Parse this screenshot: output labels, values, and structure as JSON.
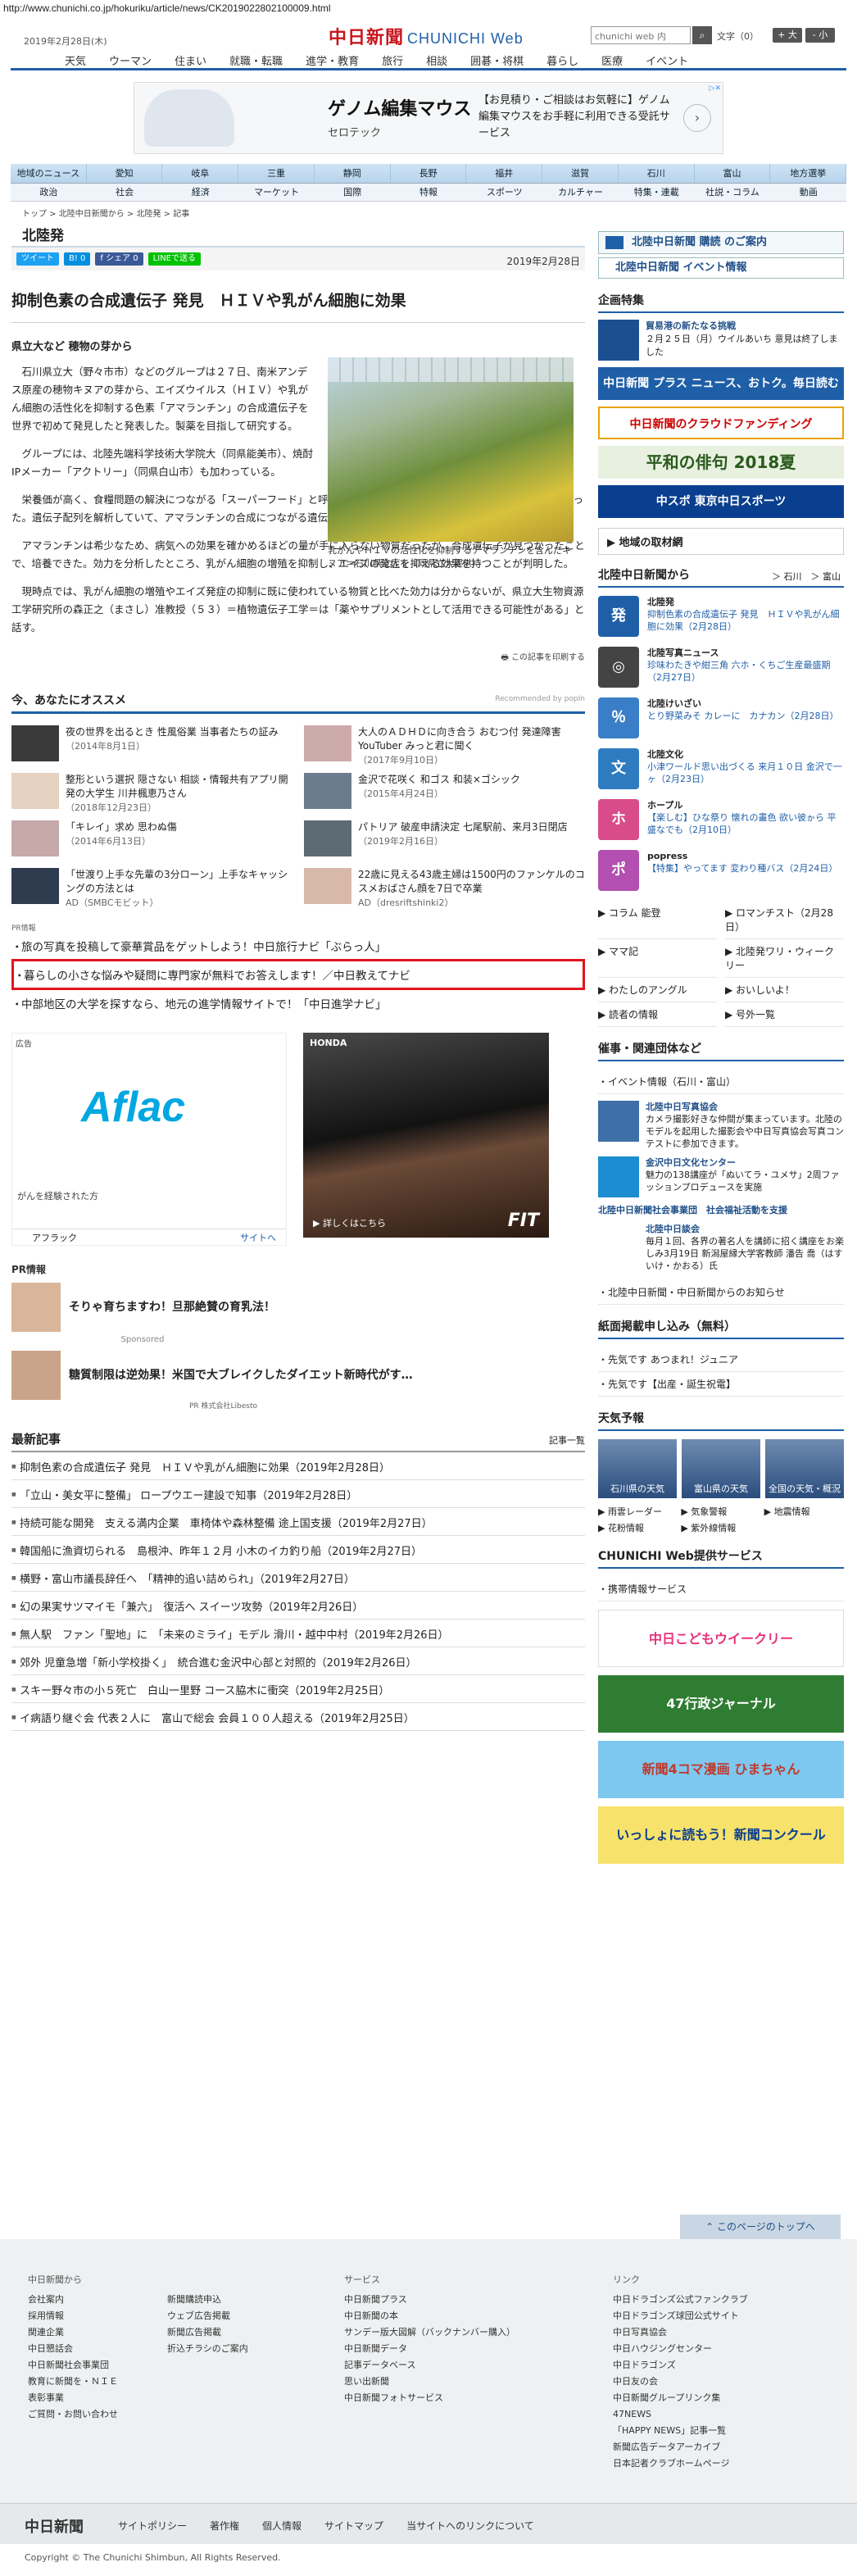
{
  "url": "http://www.chunichi.co.jp/hokuriku/article/news/CK2019022802100009.html",
  "header": {
    "date": "2019年2月28日(木)",
    "logo": "中日新聞",
    "logo_web": "CHUNICHI Web",
    "search_placeholder": "chunichi web 内",
    "memo": "文字（0）",
    "font_large": "+ 大",
    "font_small": "- 小"
  },
  "gnav": [
    "天気",
    "ウーマン",
    "住まい",
    "就職・転職",
    "進学・教育",
    "旅行",
    "相談",
    "囲碁・将棋",
    "暮らし",
    "医療",
    "イベント"
  ],
  "top_ad": {
    "title": "ゲノム編集マウス",
    "brand": "セロテック",
    "text": "【お見積り・ご相談はお気軽に】ゲノム編集マウスをお手軽に利用できる受託サービス",
    "arrow": "›"
  },
  "subnav1": [
    "地域のニュース",
    "愛知",
    "岐阜",
    "三重",
    "静岡",
    "長野",
    "福井",
    "滋賀",
    "石川",
    "富山",
    "地方選挙"
  ],
  "subnav2": [
    "政治",
    "社会",
    "経済",
    "マーケット",
    "国際",
    "特報",
    "スポーツ",
    "カルチャー",
    "特集・連載",
    "社説・コラム",
    "動画"
  ],
  "breadcrumb": "トップ > 北陸中日新聞から > 北陸発 > 記事",
  "section_title": "北陸発",
  "share": {
    "tweet": "ツイート",
    "hatena": "B! 0",
    "fb": "f シェア 0",
    "line": "LINEで送る",
    "pub_date": "2019年2月28日"
  },
  "article": {
    "title": "抑制色素の合成遺伝子 発見　ＨＩＶや乳がん細胞に効果",
    "subtitle": "県立大など 穂物の芽から",
    "caption": "乳がんやＨＩＶの活性化を抑制するアマランチンを含んだキヌア＝石川県立大で（同県立大提供）",
    "p1": "石川県立大（野々市市）などのグループは２７日、南米アンデス原産の穂物キヌアの芽から、エイズウイルス（ＨＩＶ）や乳がん細胞の活性化を抑制する色素「アマランチン」の合成遺伝子を世界で初めて発見したと発表した。製薬を目指して研究する。",
    "p2": "グループには、北陸先端科学技術大学院大（同県能美市）、焼酎IPメーカー「アクトリー」（同県白山市）も加わっている。",
    "p3": "栄養価が高く、食糧問題の解決につながる「スーパーフード」と呼ばれるキヌアの栽培方法を探っている過程で、見つかった。遺伝子配列を解析していて、アマランチンの合成につながる遺伝子が含まれているのが明らかになった。",
    "p4": "アマランチンは希少なため、病気への効果を確かめるほどの量が手に入らない物質だったが、合成遺伝子が見つかったことで、培養できた。効力を分析したところ、乳がん細胞の増殖を抑制し、エイズの発症を抑える効果を持つことが判明した。",
    "p5": "現時点では、乳がん細胞の増殖やエイズ発症の抑制に既に使われている物質と比べた効力は分からないが、県立大生物資源工学研究所の森正之（まさし）准教授（５３）＝植物遺伝子工学＝は「薬やサプリメントとして活用できる可能性がある」と話す。",
    "share_note": "この記事を印刷する"
  },
  "recommend": {
    "title": "今、あなたにオススメ",
    "by": "Recommended by popIn",
    "items": [
      {
        "title": "夜の世界を出るとき 性風俗業 当事者たちの証み",
        "sub": "（2014年8月1日）"
      },
      {
        "title": "大人のＡＤＨＤに向き合う おむつ付 発達障害YouTuber みっと君に聞く",
        "sub": "（2017年9月10日）"
      },
      {
        "title": "整形という選択 隠さない 相談・情報共有アプリ開発の大学生 川井楓恵乃さん",
        "sub": "（2018年12月23日）"
      },
      {
        "title": "金沢で花咲く 和ゴス 和装×ゴシック",
        "sub": "（2015年4月24日）"
      },
      {
        "title": "「キレイ」求め 思わぬ傷",
        "sub": "（2014年6月13日）"
      },
      {
        "title": "パトリア 破産申請決定 七尾駅前、来月3日閉店",
        "sub": "（2019年2月16日）"
      },
      {
        "title": "「世渡り上手な先輩の3分ローン」上手なキャッシングの方法とは",
        "sub": "AD（SMBCモビット）"
      },
      {
        "title": "22歳に見える43歳主婦は1500円のファンケルのコスメおばさん顔を7日で卒業",
        "sub": "AD（dresriftshinki2）"
      }
    ]
  },
  "pr_label": "PR情報",
  "pr_list": [
    "旅の写真を投稿して豪華賞品をゲットしよう！中日旅行ナビ「ぶらっ人」",
    "暮らしの小さな悩みや疑問に専門家が無料でお答えします！／中日教えてナビ",
    "中部地区の大学を探すなら、地元の進学情報サイトで！「中日進学ナビ」"
  ],
  "ads": {
    "tag": "広告",
    "aflac_logo": "Aflac",
    "aflac_desc": "がんを経験された方",
    "aflac_name": "アフラック",
    "aflac_site": "サイトへ",
    "honda_logo": "HONDA",
    "honda_more": "▶ 詳しくはこちら",
    "honda_fit": "FIT"
  },
  "pr2": {
    "head": "PR情報",
    "items": [
      "そりゃ育ちますわ！旦那絶賛の育乳法！",
      "糖質制限は逆効果！米国で大ブレイクしたダイエット新時代がす…"
    ],
    "sponsored": "Sponsored",
    "foot": "PR 株式会社Libesto"
  },
  "latest": {
    "title": "最新記事",
    "all": "記事一覧",
    "items": [
      "抑制色素の合成遺伝子 発見　ＨＩＶや乳がん細胞に効果（2019年2月28日）",
      "「立山・美女平に整備」 ロープウエー建設で知事（2019年2月28日）",
      "持続可能な開発　支える満内企業　車椅体や森林整備 途上国支援（2019年2月27日）",
      "韓国船に漁資切られる　島根沖、昨年１２月 小木のイカ釣り船（2019年2月27日）",
      "横野・富山市議長辞任へ　「精神的追い詰められ」（2019年2月27日）",
      "幻の果実サツマイモ「兼六」　復活へ スイーツ攻勢（2019年2月26日）",
      "無人駅　ファン「聖地」に　「未来のミライ」モデル 滑川・越中中村（2019年2月26日）",
      "郊外 児童急増「新小学校掛く」　統合進む金沢中心部と対照的（2019年2月26日）",
      "スキー野々市の小５死亡　白山一里野 コース脇木に衝突（2019年2月25日）",
      "イ病語り継ぐ会 代表２人に　富山で総会 会員１００人超える（2019年2月25日）"
    ]
  },
  "side": {
    "banner1": "北陸中日新聞 購読 のご案内",
    "banner2": "北陸中日新聞 イベント情報",
    "kikaku_head": "企画特集",
    "kikaku_title": "貿易港の新たなる挑戦",
    "kikaku_desc": "２月２５日（月）ウイルあいち 意見は終了しました",
    "ad1": "中日新聞 プラス ニュース、おトク。毎日読むならここ。",
    "ad2": "中日新聞のクラウドファンディング",
    "ad3": "平和の俳句 2018夏",
    "ad4": "中スポ 東京中日スポーツ",
    "torizai": "▶ 地域の取材網",
    "hk_head": "北陸中日新聞から",
    "hk_tabs": "＞ 石川　＞ 富山",
    "hk_items": [
      {
        "icon": "発",
        "color": "#1f5fa8",
        "cat": "北陸発",
        "txt": "抑制色素の合成遺伝子 発見　ＨＩＶや乳がん細胞に効果（2月28日）"
      },
      {
        "icon": "◎",
        "color": "#444",
        "cat": "北陸写真ニュース",
        "txt": "珍味わたきや紺三角 六ホ・くちご生産最盛期（2月27日）"
      },
      {
        "icon": "％",
        "color": "#3b7ec8",
        "cat": "北陸けいざい",
        "txt": "とり野菜みそ カレーに　カナカン（2月28日）"
      },
      {
        "icon": "文",
        "color": "#2e7cbf",
        "cat": "北陸文化",
        "txt": "小津ワールド思い出づくる 来月１０日 金沢で一ヶ（2月23日）"
      },
      {
        "icon": "ホ",
        "color": "#d84c8a",
        "cat": "ホープル",
        "txt": "【楽しむ】ひな祭り 懐れの畫色 欲い彼ゕら 平盛なでも（2月10日）"
      },
      {
        "icon": "ポ",
        "color": "#b24fb0",
        "cat": "popress",
        "txt": "【特集】やってます 変わり種バス（2月24日）"
      }
    ],
    "links": [
      "コラム 能登",
      "ロマンチスト（2月28日）",
      "ママ記",
      "北陸発ワリ・ウィークリー",
      "わたしのアングル",
      "おいしいよ！",
      "読者の情報",
      "号外一覧"
    ],
    "dant_head": "催事・関連団体など",
    "dant_list": [
      "イベント情報（石川・富山）"
    ],
    "dant_items": [
      {
        "title": "北陸中日写真協会",
        "txt": "カメラ撮影好きな仲間が集まっています。北陸のモデルを起用した撮影会や中日写真協会写真コンテストに参加できます。"
      },
      {
        "title": "金沢中日文化センター",
        "txt": "魅力の138講座が「ぬいてラ・ユメサ」2周ファッションプロデュースを実施"
      },
      {
        "title": "北陸中日新聞社会事業団　社会福祉活動を支援",
        "txt": ""
      },
      {
        "title": "北陸中日談会",
        "txt": "毎月１回、各界の著名人を講師に招く講座をお楽しみ3月19日 新潟屋縁大学客教師 潘告 喬（はすいけ・かおる）氏"
      }
    ],
    "dant_more": "北陸中日新聞・中日新聞からのお知らせ",
    "shi_head": "紙面掲載申し込み（無料）",
    "shi_list": [
      "先気です あつまれ！ジュニア",
      "先気です【出産・誕生祝電】"
    ],
    "weather_head": "天気予報",
    "weather": [
      "石川県の天気",
      "富山県の天気",
      "全国の天気・概況"
    ],
    "weather_links": [
      "雨雲レーダー",
      "気象警報",
      "地震情報",
      "花粉情報",
      "紫外線情報"
    ],
    "service_head": "CHUNICHI Web提供サービス",
    "service_list": [
      "携帯情報サービス"
    ],
    "b1": "中日こどもウイークリー",
    "b2": "47行政ジャーナル",
    "b3": "新聞4コマ漫画 ひまちゃん",
    "b4": "いっしょに読もう！新聞コンクール"
  },
  "pagetop": "このページのトップへ",
  "footer": {
    "col1_head": "中日新聞から",
    "col1": [
      "会社案内",
      "採用情報",
      "関連企業",
      "中日懇話会",
      "中日新聞社会事業団",
      "教育に新聞を・ＮＩＥ",
      "表彰事業",
      "ご質問・お問い合わせ"
    ],
    "col2": [
      "新聞購読申込",
      "ウェブ広告掲載",
      "新聞広告掲載",
      "折込チラシのご案内"
    ],
    "col3_head": "サービス",
    "col3": [
      "中日新聞プラス",
      "中日新聞の本",
      "サンデー版大図解（バックナンバー購入）",
      "中日新聞データ",
      "記事データベース",
      "思い出新聞",
      "中日新聞フォトサービス"
    ],
    "col4_head": "リンク",
    "col4": [
      "中日ドラゴンズ公式ファンクラブ",
      "中日ドラゴンズ球団公式サイト",
      "中日写真協会",
      "中日ハウジングセンター",
      "中日ドラゴンズ",
      "中日友の会",
      "中日新聞グループリンク集",
      "47NEWS",
      "「HAPPY NEWS」記事一覧",
      "新聞広告データアーカイブ",
      "日本記者クラブホームページ"
    ],
    "bottom_logo": "中日新聞",
    "bottom": [
      "サイトポリシー",
      "著作権",
      "個人情報",
      "サイトマップ",
      "当サイトへのリンクについて"
    ],
    "copyright": "Copyright © The Chunichi Shimbun, All Rights Reserved."
  }
}
